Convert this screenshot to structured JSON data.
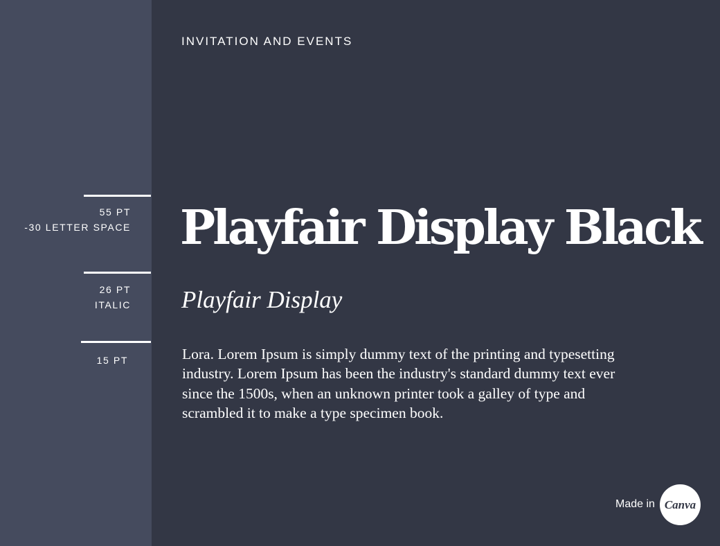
{
  "category_label": "INVITATION AND EVENTS",
  "specs": [
    {
      "lines": [
        "55 PT",
        "-30 LETTER SPACE"
      ]
    },
    {
      "lines": [
        "26 PT",
        "ITALIC"
      ]
    },
    {
      "lines": [
        "15 PT"
      ]
    }
  ],
  "samples": {
    "display_black": "Playfair Display Black",
    "display_italic": "Playfair Display",
    "body_lines": [
      "Lora. Lorem Ipsum is simply dummy text of the printing and typesetting",
      "industry. Lorem Ipsum has been the industry's standard dummy text ever",
      "since the 1500s, when an unknown printer took a galley of type and",
      "scrambled it to make a type specimen book."
    ]
  },
  "branding": {
    "made_in_label": "Made in",
    "logo_text": "Canva"
  },
  "colors": {
    "background": "#333745",
    "sidebar": "#454b5e",
    "text": "#ffffff"
  }
}
